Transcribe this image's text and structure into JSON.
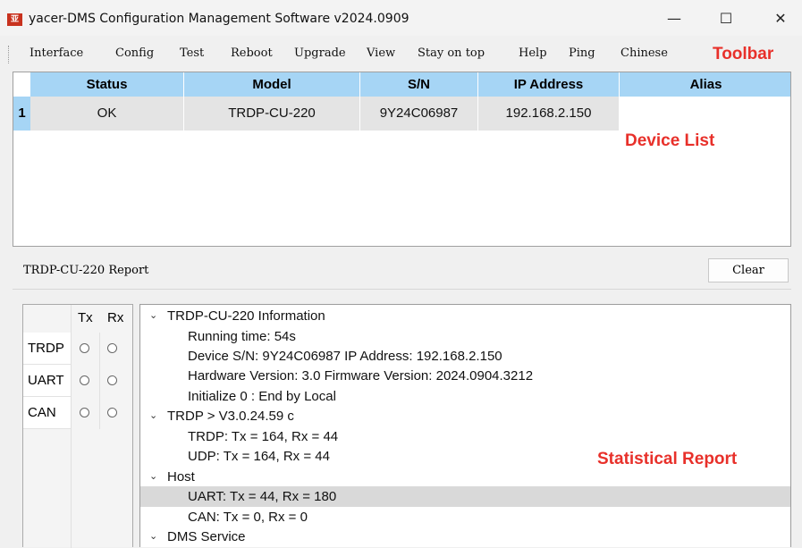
{
  "window": {
    "title": "yacer-DMS Configuration Management Software v2024.0909",
    "icon_glyph": "亚",
    "minimize": "—",
    "maximize": "☐",
    "close": "✕"
  },
  "menu": [
    "Interface",
    "Config",
    "Test",
    "Reboot",
    "Upgrade",
    "View",
    "Stay on top",
    "Help",
    "Ping",
    "Chinese"
  ],
  "annotations": {
    "toolbar": "Toolbar",
    "device_list": "Device List",
    "statistical_report": "Statistical Report"
  },
  "device_list": {
    "columns": [
      "Status",
      "Model",
      "S/N",
      "IP Address",
      "Alias"
    ],
    "rows": [
      {
        "index": "1",
        "status": "OK",
        "model": "TRDP-CU-220",
        "sn": "9Y24C06987",
        "ip": "192.168.2.150",
        "alias": ""
      }
    ]
  },
  "report": {
    "title": "TRDP-CU-220 Report",
    "clear_label": "Clear"
  },
  "io_panel": {
    "headers": [
      "Tx",
      "Rx"
    ],
    "rows": [
      "TRDP",
      "UART",
      "CAN"
    ]
  },
  "tree": [
    {
      "text": "TRDP-CU-220 Information",
      "level": 0,
      "expanded": true
    },
    {
      "text": "Running time: 54s",
      "level": 1
    },
    {
      "text": "Device S/N: 9Y24C06987   IP Address: 192.168.2.150",
      "level": 1
    },
    {
      "text": "Hardware Version: 3.0   Firmware Version: 2024.0904.3212",
      "level": 1
    },
    {
      "text": "Initialize 0 : End by Local",
      "level": 1
    },
    {
      "text": "TRDP > V3.0.24.59   c",
      "level": 0,
      "expanded": true
    },
    {
      "text": "TRDP: Tx = 164, Rx = 44",
      "level": 1
    },
    {
      "text": "UDP: Tx = 164, Rx = 44",
      "level": 1
    },
    {
      "text": "Host",
      "level": 0,
      "expanded": true
    },
    {
      "text": "UART: Tx = 44, Rx = 180",
      "level": 1,
      "selected": true
    },
    {
      "text": "CAN: Tx = 0, Rx = 0",
      "level": 1
    },
    {
      "text": "DMS Service",
      "level": 0,
      "expanded": true
    }
  ],
  "colors": {
    "header_blue": "#a6d5f5",
    "annotation_red": "#e8302a",
    "icon_red": "#c8321e"
  }
}
